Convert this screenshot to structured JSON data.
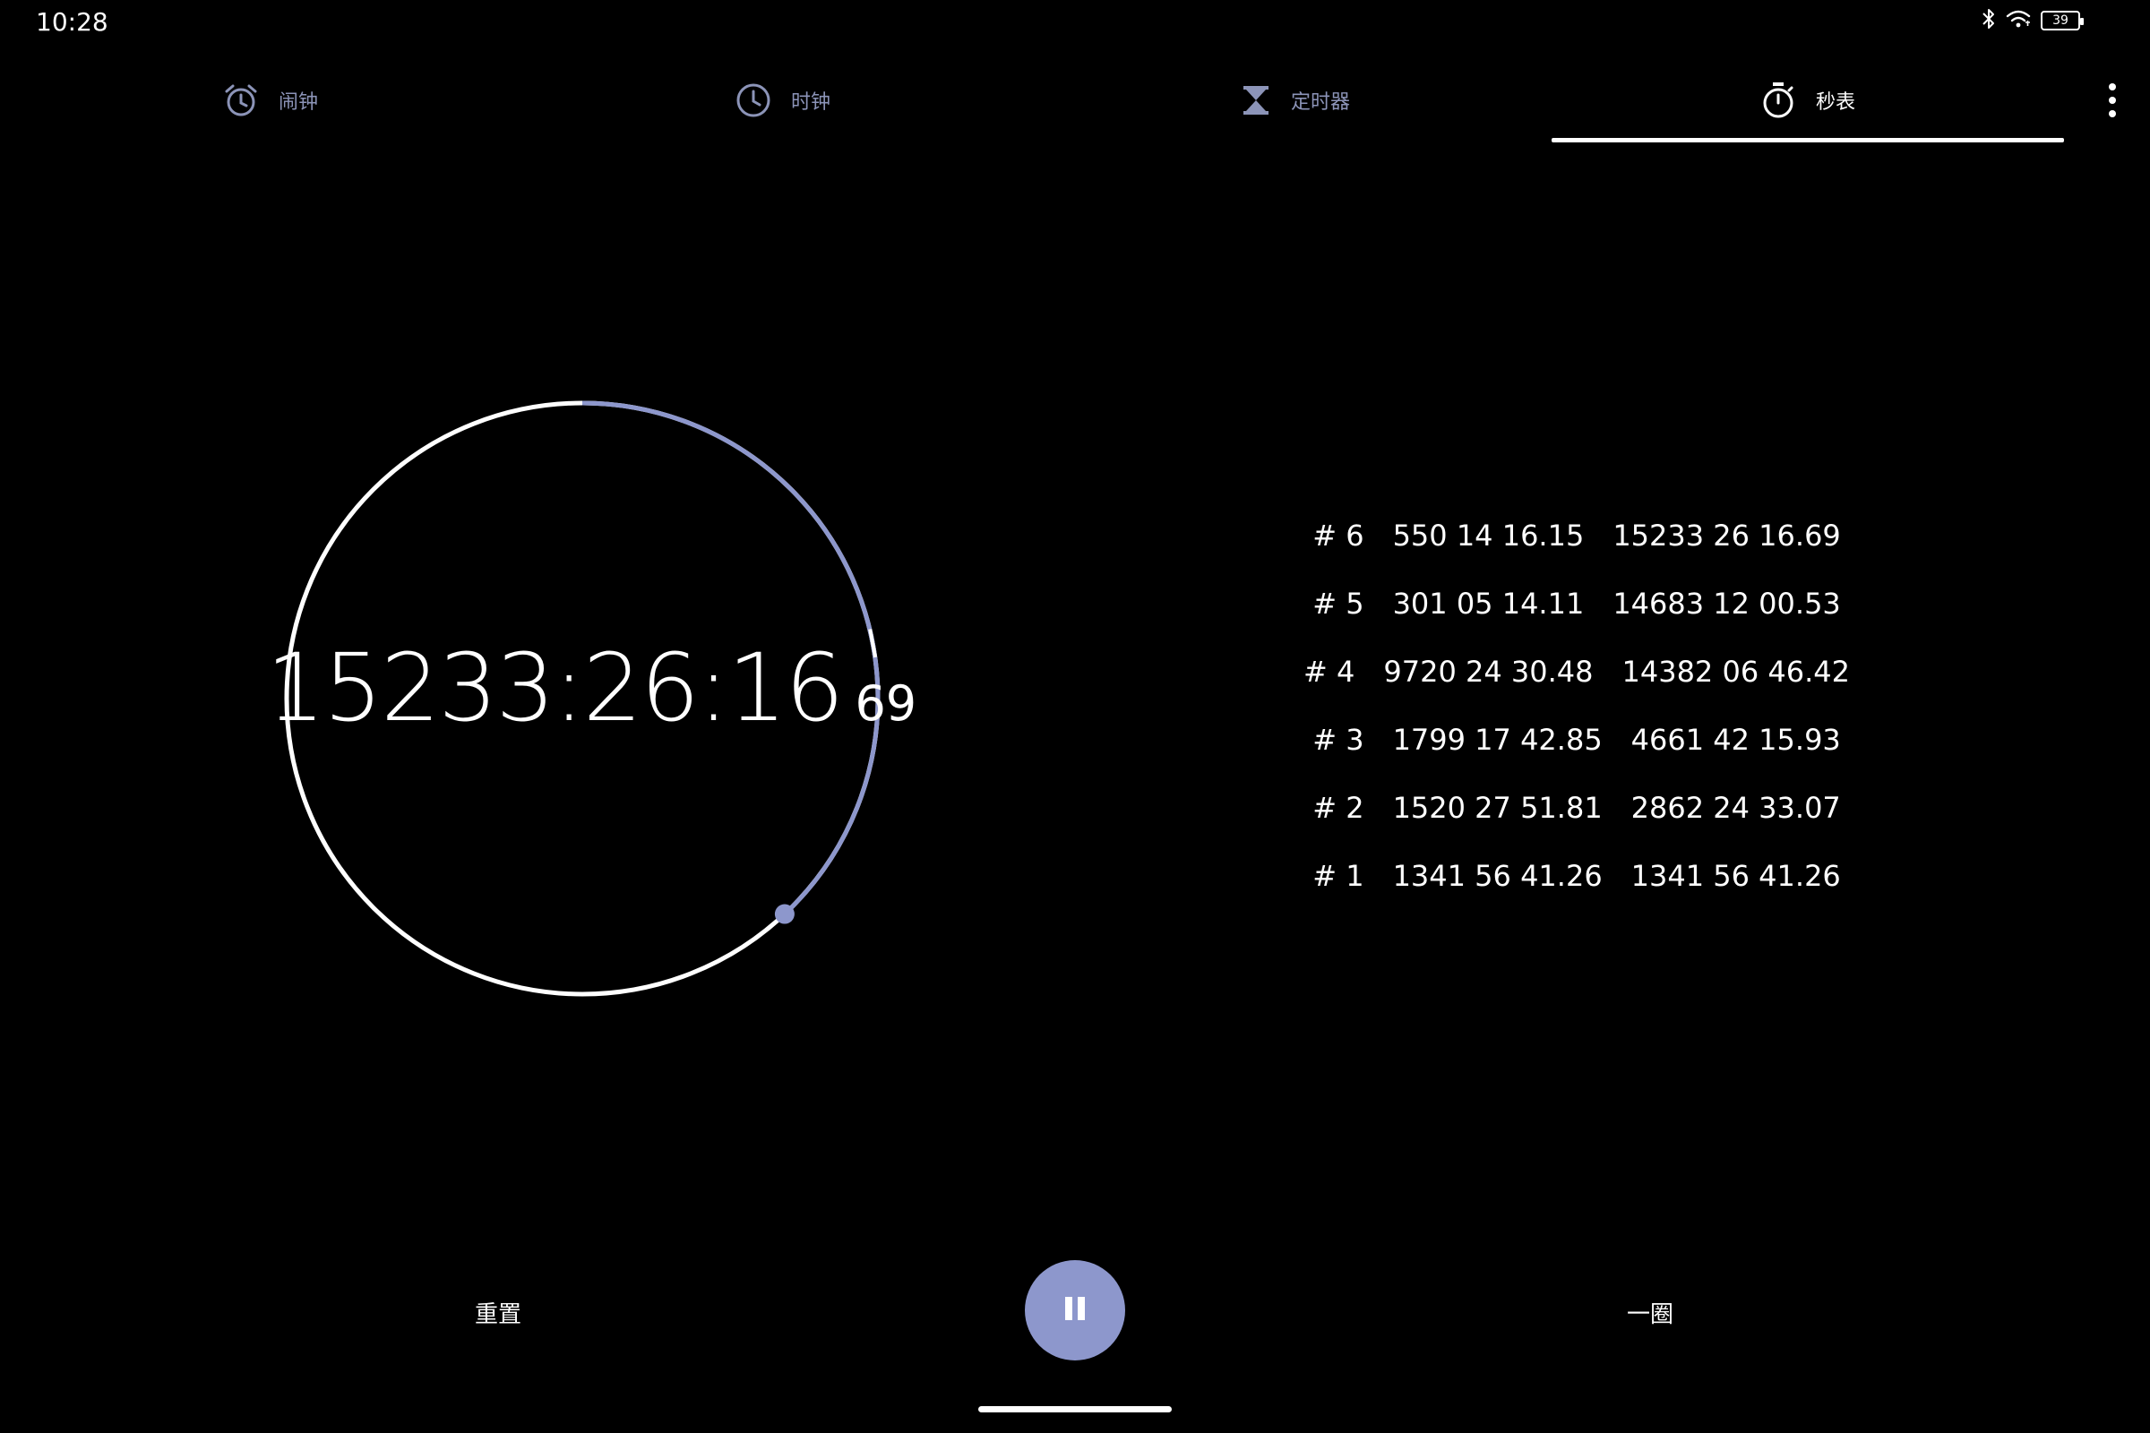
{
  "status_bar": {
    "time": "10:28",
    "battery": "39",
    "icons": [
      "bluetooth-icon",
      "wifi-icon",
      "battery-icon"
    ]
  },
  "tabs": [
    {
      "label": "闹钟",
      "icon": "alarm-icon",
      "active": false
    },
    {
      "label": "时钟",
      "icon": "clock-icon",
      "active": false
    },
    {
      "label": "定时器",
      "icon": "hourglass-icon",
      "active": false
    },
    {
      "label": "秒表",
      "icon": "stopwatch-icon",
      "active": true
    }
  ],
  "stopwatch": {
    "elapsed": "15233:26:16",
    "hundredths": "69",
    "progress_fraction": 0.38
  },
  "laps": [
    {
      "number": "# 6",
      "lap_time": "550 14 16.15",
      "total_time": "15233 26 16.69"
    },
    {
      "number": "# 5",
      "lap_time": "301 05 14.11",
      "total_time": "14683 12 00.53"
    },
    {
      "number": "# 4",
      "lap_time": "9720 24 30.48",
      "total_time": "14382 06 46.42"
    },
    {
      "number": "# 3",
      "lap_time": "1799 17 42.85",
      "total_time": "4661 42 15.93"
    },
    {
      "number": "# 2",
      "lap_time": "1520 27 51.81",
      "total_time": "2862 24 33.07"
    },
    {
      "number": "# 1",
      "lap_time": "1341 56 41.26",
      "total_time": "1341 56 41.26"
    }
  ],
  "controls": {
    "reset_label": "重置",
    "lap_label": "一圈",
    "pause_icon": "pause-icon"
  },
  "colors": {
    "accent": "#8d97cc",
    "inactive_tab": "#8c94b8",
    "background": "#000000"
  }
}
